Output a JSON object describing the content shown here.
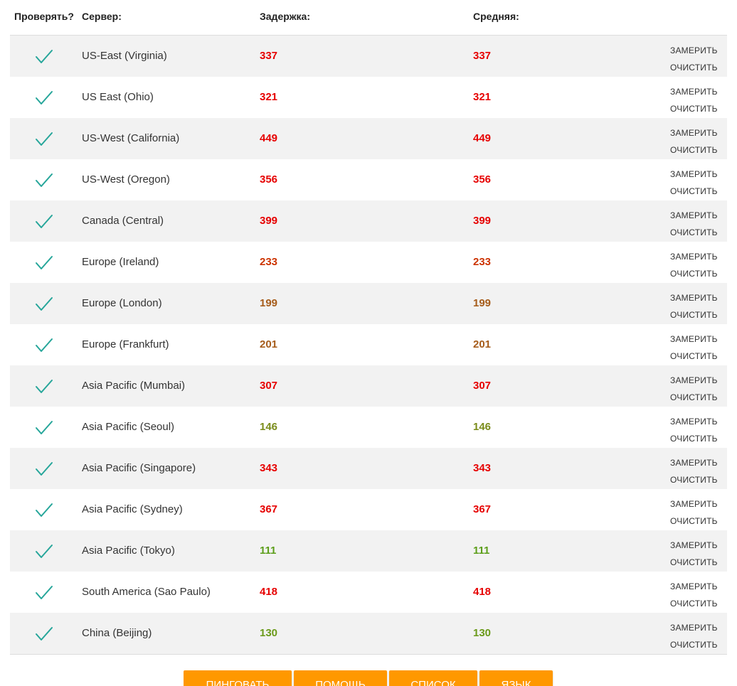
{
  "header": {
    "check": "Проверять?",
    "server": "Сервер:",
    "latency": "Задержка:",
    "average": "Средняя:"
  },
  "colors": {
    "check": "#26a69a",
    "button": "#ff9800",
    "stripe": "#f2f2f2"
  },
  "rows": [
    {
      "server": "US-East (Virginia)",
      "latency": "337",
      "average": "337",
      "color": "#e60000",
      "checked": true,
      "measure": "ЗАМЕРИТЬ",
      "clear": "ОЧИСТИТЬ"
    },
    {
      "server": "US East (Ohio)",
      "latency": "321",
      "average": "321",
      "color": "#e60000",
      "checked": true,
      "measure": "ЗАМЕРИТЬ",
      "clear": "ОЧИСТИТЬ"
    },
    {
      "server": "US-West (California)",
      "latency": "449",
      "average": "449",
      "color": "#e60000",
      "checked": true,
      "measure": "ЗАМЕРИТЬ",
      "clear": "ОЧИСТИТЬ"
    },
    {
      "server": "US-West (Oregon)",
      "latency": "356",
      "average": "356",
      "color": "#e60000",
      "checked": true,
      "measure": "ЗАМЕРИТЬ",
      "clear": "ОЧИСТИТЬ"
    },
    {
      "server": "Canada (Central)",
      "latency": "399",
      "average": "399",
      "color": "#e60000",
      "checked": true,
      "measure": "ЗАМЕРИТЬ",
      "clear": "ОЧИСТИТЬ"
    },
    {
      "server": "Europe (Ireland)",
      "latency": "233",
      "average": "233",
      "color": "#cc3300",
      "checked": true,
      "measure": "ЗАМЕРИТЬ",
      "clear": "ОЧИСТИТЬ"
    },
    {
      "server": "Europe (London)",
      "latency": "199",
      "average": "199",
      "color": "#a65c1a",
      "checked": true,
      "measure": "ЗАМЕРИТЬ",
      "clear": "ОЧИСТИТЬ"
    },
    {
      "server": "Europe (Frankfurt)",
      "latency": "201",
      "average": "201",
      "color": "#a65c1a",
      "checked": true,
      "measure": "ЗАМЕРИТЬ",
      "clear": "ОЧИСТИТЬ"
    },
    {
      "server": "Asia Pacific (Mumbai)",
      "latency": "307",
      "average": "307",
      "color": "#e60000",
      "checked": true,
      "measure": "ЗАМЕРИТЬ",
      "clear": "ОЧИСТИТЬ"
    },
    {
      "server": "Asia Pacific (Seoul)",
      "latency": "146",
      "average": "146",
      "color": "#7a8c1a",
      "checked": true,
      "measure": "ЗАМЕРИТЬ",
      "clear": "ОЧИСТИТЬ"
    },
    {
      "server": "Asia Pacific (Singapore)",
      "latency": "343",
      "average": "343",
      "color": "#e60000",
      "checked": true,
      "measure": "ЗАМЕРИТЬ",
      "clear": "ОЧИСТИТЬ"
    },
    {
      "server": "Asia Pacific (Sydney)",
      "latency": "367",
      "average": "367",
      "color": "#e60000",
      "checked": true,
      "measure": "ЗАМЕРИТЬ",
      "clear": "ОЧИСТИТЬ"
    },
    {
      "server": "Asia Pacific (Tokyo)",
      "latency": "111",
      "average": "111",
      "color": "#5c9e1a",
      "checked": true,
      "measure": "ЗАМЕРИТЬ",
      "clear": "ОЧИСТИТЬ"
    },
    {
      "server": "South America (Sao Paulo)",
      "latency": "418",
      "average": "418",
      "color": "#e60000",
      "checked": true,
      "measure": "ЗАМЕРИТЬ",
      "clear": "ОЧИСТИТЬ"
    },
    {
      "server": "China (Beijing)",
      "latency": "130",
      "average": "130",
      "color": "#6b9a1a",
      "checked": true,
      "measure": "ЗАМЕРИТЬ",
      "clear": "ОЧИСТИТЬ"
    }
  ],
  "buttons": [
    {
      "label": "ПИНГОВАТЬ"
    },
    {
      "label": "ПОМОЩЬ"
    },
    {
      "label": "СПИСОК"
    },
    {
      "label": "ЯЗЫК"
    }
  ]
}
